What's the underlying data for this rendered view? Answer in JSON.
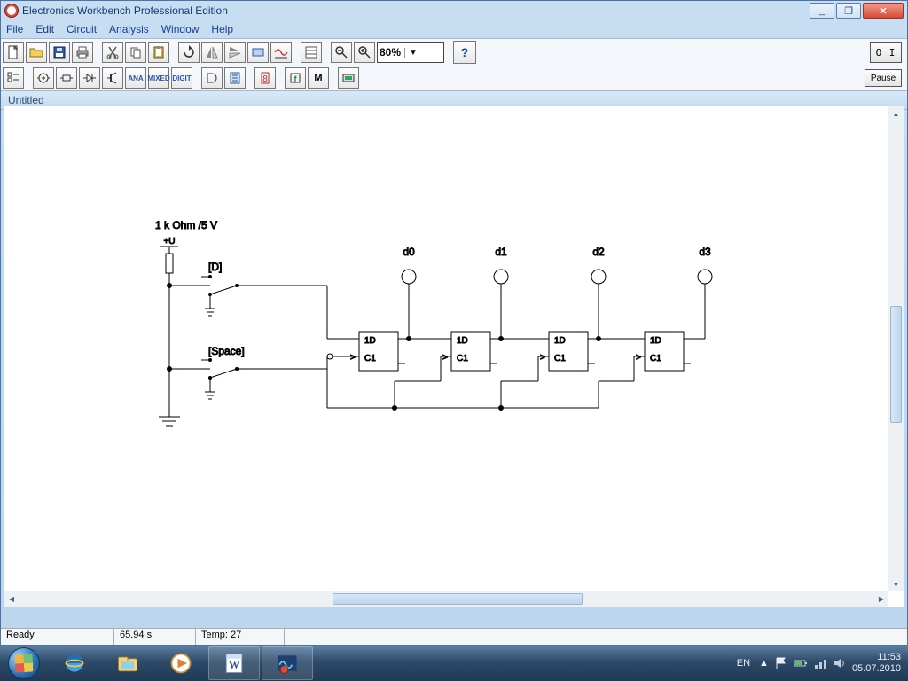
{
  "window": {
    "title": "Electronics Workbench Professional Edition",
    "minimize_icon": "_",
    "maximize_icon": "❐",
    "close_icon": "✕"
  },
  "menu": {
    "file": "File",
    "edit": "Edit",
    "circuit": "Circuit",
    "analysis": "Analysis",
    "window": "Window",
    "help": "Help"
  },
  "toolbar": {
    "zoom": "80%",
    "help_label": "?",
    "power": "O I",
    "pause": "Pause",
    "row2_labels": {
      "ana": "ANA",
      "mixed": "MIXED",
      "digit": "DIGIT",
      "m": "M"
    }
  },
  "document": {
    "title": "Untitled"
  },
  "circuit": {
    "power_label": "1 k Ohm /5 V",
    "vcc": "+U",
    "switch_d": "[D]",
    "switch_space": "[Space]",
    "probes": [
      "d0",
      "d1",
      "d2",
      "d3"
    ],
    "ff": {
      "d": "1D",
      "c": "C1"
    },
    "clk_marker": ">"
  },
  "status": {
    "ready": "Ready",
    "time": "65.94 s",
    "temp": "Temp: 27"
  },
  "taskbar": {
    "lang": "EN",
    "clock_time": "11:53",
    "clock_date": "05.07.2010",
    "tray_expand": "▲"
  }
}
